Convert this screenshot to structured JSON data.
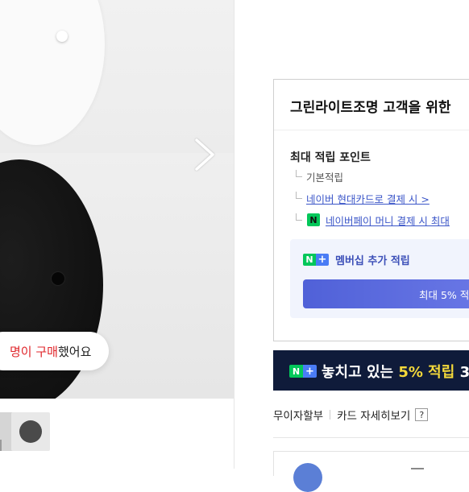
{
  "gallery": {
    "bubble": {
      "red_text": "명이 구매",
      "dark_text": " 했어요"
    }
  },
  "benefit": {
    "title": "그린라이트조명 고객을 위한",
    "max_points_label": "최대 적립 포인트",
    "rows": {
      "basic": "기본적립",
      "card": "네이버 현대카드로 결제 시 >",
      "npay_icon": "N",
      "npay": "네이버페이 머니 결제 시 최대"
    },
    "membership": {
      "badge_n": "N",
      "badge_plus": "+",
      "label": "멤버십 추가 적립",
      "button": "최대 5% 적"
    }
  },
  "banner": {
    "badge_n": "N",
    "badge_plus": "+",
    "text_before": "놓치고 있는 ",
    "text_highlight": "5% 적립",
    "text_after": " 3"
  },
  "payment": {
    "installment": "무이자할부",
    "card_detail": "카드 자세히보기",
    "help": "?"
  },
  "colors": {
    "accent_green": "#03c75a",
    "accent_blue": "#4a7cf5",
    "link_blue": "#3a55c8",
    "banner_bg": "#0f1b3a",
    "highlight_yellow": "#f3d83a",
    "bubble_red": "#e0262b"
  }
}
